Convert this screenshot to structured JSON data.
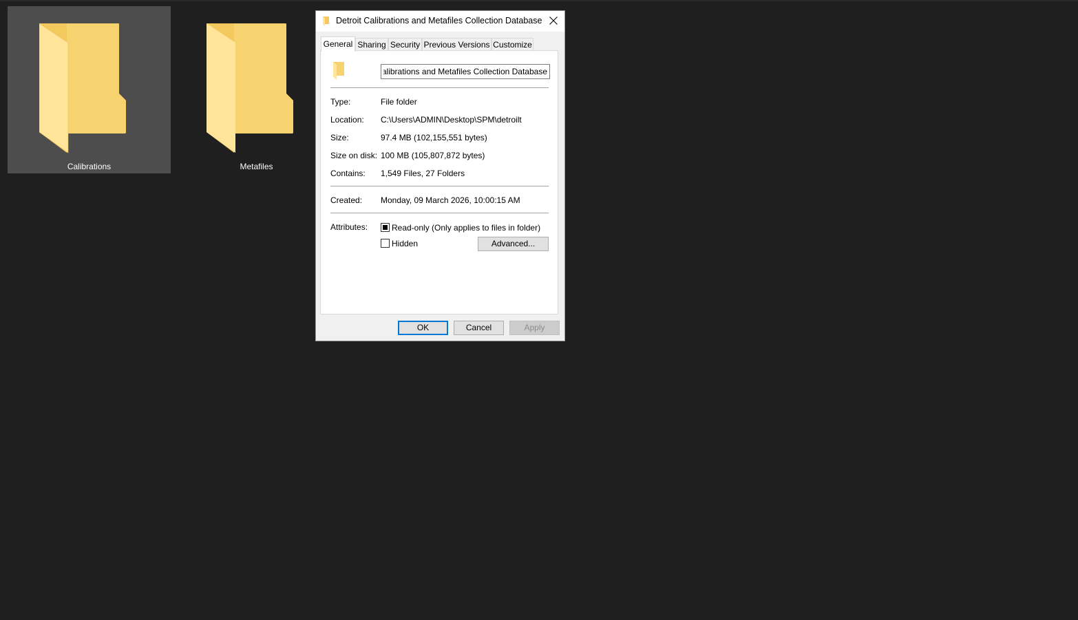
{
  "desktop": {
    "folders": [
      {
        "label": "Calibrations",
        "selected": true
      },
      {
        "label": "Metafiles",
        "selected": false
      }
    ]
  },
  "dialog": {
    "title": "Detroit Calibrations and Metafiles Collection Database ...",
    "close_icon": "close-icon",
    "tabs": [
      {
        "label": "General",
        "active": true
      },
      {
        "label": "Sharing"
      },
      {
        "label": "Security"
      },
      {
        "label": "Previous Versions"
      },
      {
        "label": "Customize"
      }
    ],
    "general": {
      "name_value": "Detroit Calibrations and Metafiles Collection Database",
      "type_label": "Type:",
      "type_value": "File folder",
      "location_label": "Location:",
      "location_value": "C:\\Users\\ADMIN\\Desktop\\SPM\\detroilt",
      "size_label": "Size:",
      "size_value": "97.4 MB (102,155,551 bytes)",
      "size_on_disk_label": "Size on disk:",
      "size_on_disk_value": "100 MB (105,807,872 bytes)",
      "contains_label": "Contains:",
      "contains_value": "1,549 Files, 27 Folders",
      "created_label": "Created:",
      "created_value": "Monday, 09 March 2026, 10:00:15 AM",
      "attributes_label": "Attributes:",
      "readonly_label": "Read-only (Only applies to files in folder)",
      "readonly_state": "indeterminate",
      "hidden_label": "Hidden",
      "hidden_checked": false,
      "advanced_label": "Advanced..."
    },
    "buttons": {
      "ok": "OK",
      "cancel": "Cancel",
      "apply": "Apply"
    }
  },
  "colors": {
    "desktop_bg": "#1f1f1f",
    "selection": "#4d4d4d",
    "folder_yellow": "#f8d675",
    "accent": "#0078d7"
  }
}
